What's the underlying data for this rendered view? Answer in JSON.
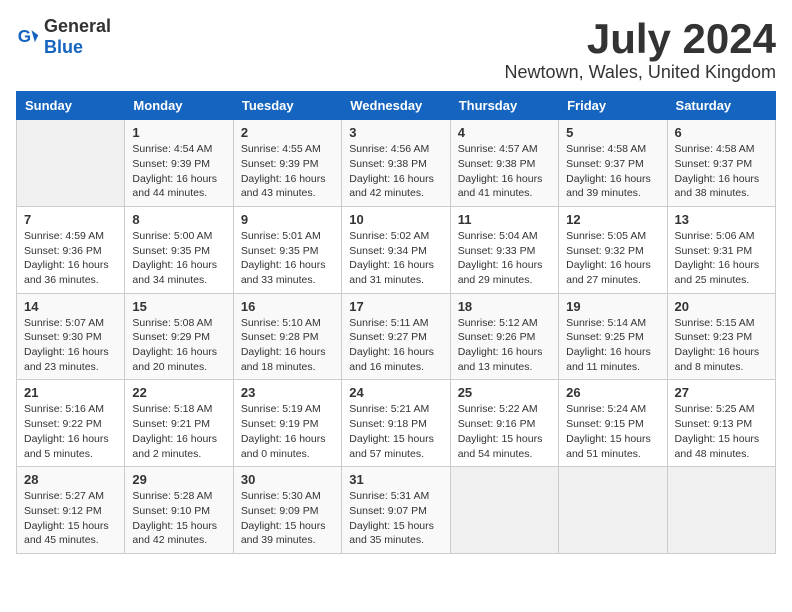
{
  "header": {
    "logo_general": "General",
    "logo_blue": "Blue",
    "month": "July 2024",
    "location": "Newtown, Wales, United Kingdom"
  },
  "days_of_week": [
    "Sunday",
    "Monday",
    "Tuesday",
    "Wednesday",
    "Thursday",
    "Friday",
    "Saturday"
  ],
  "weeks": [
    [
      {
        "day": "",
        "info": ""
      },
      {
        "day": "1",
        "info": "Sunrise: 4:54 AM\nSunset: 9:39 PM\nDaylight: 16 hours\nand 44 minutes."
      },
      {
        "day": "2",
        "info": "Sunrise: 4:55 AM\nSunset: 9:39 PM\nDaylight: 16 hours\nand 43 minutes."
      },
      {
        "day": "3",
        "info": "Sunrise: 4:56 AM\nSunset: 9:38 PM\nDaylight: 16 hours\nand 42 minutes."
      },
      {
        "day": "4",
        "info": "Sunrise: 4:57 AM\nSunset: 9:38 PM\nDaylight: 16 hours\nand 41 minutes."
      },
      {
        "day": "5",
        "info": "Sunrise: 4:58 AM\nSunset: 9:37 PM\nDaylight: 16 hours\nand 39 minutes."
      },
      {
        "day": "6",
        "info": "Sunrise: 4:58 AM\nSunset: 9:37 PM\nDaylight: 16 hours\nand 38 minutes."
      }
    ],
    [
      {
        "day": "7",
        "info": "Sunrise: 4:59 AM\nSunset: 9:36 PM\nDaylight: 16 hours\nand 36 minutes."
      },
      {
        "day": "8",
        "info": "Sunrise: 5:00 AM\nSunset: 9:35 PM\nDaylight: 16 hours\nand 34 minutes."
      },
      {
        "day": "9",
        "info": "Sunrise: 5:01 AM\nSunset: 9:35 PM\nDaylight: 16 hours\nand 33 minutes."
      },
      {
        "day": "10",
        "info": "Sunrise: 5:02 AM\nSunset: 9:34 PM\nDaylight: 16 hours\nand 31 minutes."
      },
      {
        "day": "11",
        "info": "Sunrise: 5:04 AM\nSunset: 9:33 PM\nDaylight: 16 hours\nand 29 minutes."
      },
      {
        "day": "12",
        "info": "Sunrise: 5:05 AM\nSunset: 9:32 PM\nDaylight: 16 hours\nand 27 minutes."
      },
      {
        "day": "13",
        "info": "Sunrise: 5:06 AM\nSunset: 9:31 PM\nDaylight: 16 hours\nand 25 minutes."
      }
    ],
    [
      {
        "day": "14",
        "info": "Sunrise: 5:07 AM\nSunset: 9:30 PM\nDaylight: 16 hours\nand 23 minutes."
      },
      {
        "day": "15",
        "info": "Sunrise: 5:08 AM\nSunset: 9:29 PM\nDaylight: 16 hours\nand 20 minutes."
      },
      {
        "day": "16",
        "info": "Sunrise: 5:10 AM\nSunset: 9:28 PM\nDaylight: 16 hours\nand 18 minutes."
      },
      {
        "day": "17",
        "info": "Sunrise: 5:11 AM\nSunset: 9:27 PM\nDaylight: 16 hours\nand 16 minutes."
      },
      {
        "day": "18",
        "info": "Sunrise: 5:12 AM\nSunset: 9:26 PM\nDaylight: 16 hours\nand 13 minutes."
      },
      {
        "day": "19",
        "info": "Sunrise: 5:14 AM\nSunset: 9:25 PM\nDaylight: 16 hours\nand 11 minutes."
      },
      {
        "day": "20",
        "info": "Sunrise: 5:15 AM\nSunset: 9:23 PM\nDaylight: 16 hours\nand 8 minutes."
      }
    ],
    [
      {
        "day": "21",
        "info": "Sunrise: 5:16 AM\nSunset: 9:22 PM\nDaylight: 16 hours\nand 5 minutes."
      },
      {
        "day": "22",
        "info": "Sunrise: 5:18 AM\nSunset: 9:21 PM\nDaylight: 16 hours\nand 2 minutes."
      },
      {
        "day": "23",
        "info": "Sunrise: 5:19 AM\nSunset: 9:19 PM\nDaylight: 16 hours\nand 0 minutes."
      },
      {
        "day": "24",
        "info": "Sunrise: 5:21 AM\nSunset: 9:18 PM\nDaylight: 15 hours\nand 57 minutes."
      },
      {
        "day": "25",
        "info": "Sunrise: 5:22 AM\nSunset: 9:16 PM\nDaylight: 15 hours\nand 54 minutes."
      },
      {
        "day": "26",
        "info": "Sunrise: 5:24 AM\nSunset: 9:15 PM\nDaylight: 15 hours\nand 51 minutes."
      },
      {
        "day": "27",
        "info": "Sunrise: 5:25 AM\nSunset: 9:13 PM\nDaylight: 15 hours\nand 48 minutes."
      }
    ],
    [
      {
        "day": "28",
        "info": "Sunrise: 5:27 AM\nSunset: 9:12 PM\nDaylight: 15 hours\nand 45 minutes."
      },
      {
        "day": "29",
        "info": "Sunrise: 5:28 AM\nSunset: 9:10 PM\nDaylight: 15 hours\nand 42 minutes."
      },
      {
        "day": "30",
        "info": "Sunrise: 5:30 AM\nSunset: 9:09 PM\nDaylight: 15 hours\nand 39 minutes."
      },
      {
        "day": "31",
        "info": "Sunrise: 5:31 AM\nSunset: 9:07 PM\nDaylight: 15 hours\nand 35 minutes."
      },
      {
        "day": "",
        "info": ""
      },
      {
        "day": "",
        "info": ""
      },
      {
        "day": "",
        "info": ""
      }
    ]
  ]
}
